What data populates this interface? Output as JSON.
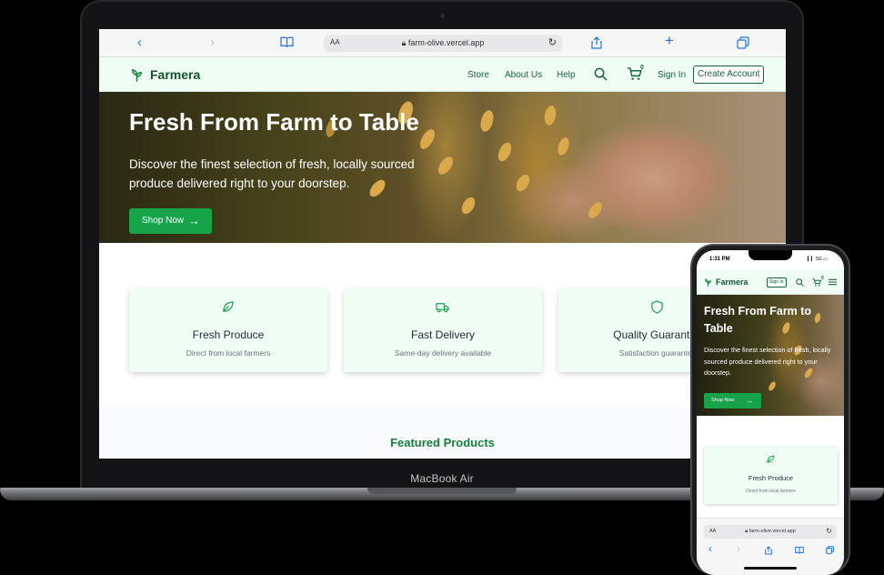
{
  "device_labels": {
    "laptop_name": "MacBook Air"
  },
  "browser": {
    "url": "farm-olive.vercel.app",
    "reader_label": "AA",
    "icons": [
      "chevron-left-icon",
      "chevron-right-icon",
      "book-icon",
      "reload-icon",
      "share-icon",
      "plus-icon",
      "tabs-icon"
    ]
  },
  "site": {
    "brand": "Farmera",
    "nav": {
      "store": "Store",
      "about": "About Us",
      "help": "Help",
      "sign_in": "Sign In",
      "create_account": "Create Account",
      "cart_count": "0"
    },
    "hero": {
      "title": "Fresh From Farm to Table",
      "subtitle": "Discover the finest selection of fresh, locally sourced produce delivered right to your doorstep.",
      "cta": "Shop Now"
    },
    "features": [
      {
        "title": "Fresh Produce",
        "subtitle": "Direct from local farmers",
        "icon": "leaf-icon"
      },
      {
        "title": "Fast Delivery",
        "subtitle": "Same-day delivery available",
        "icon": "truck-icon"
      },
      {
        "title": "Quality Guarantee",
        "subtitle": "Satisfaction guarantee",
        "icon": "shield-icon"
      }
    ],
    "featured_title": "Featured Products"
  },
  "phone": {
    "time": "1:31 PM",
    "status": "5G",
    "sign_in": "Sign In",
    "cart_count": "0",
    "url": "farm-olive.vercel.app",
    "reader_label": "AA"
  },
  "colors": {
    "brand_green": "#16a34a",
    "dark_green": "#14532d",
    "nav_bg": "#f0fdf4",
    "link_blue": "#1a73e8"
  }
}
